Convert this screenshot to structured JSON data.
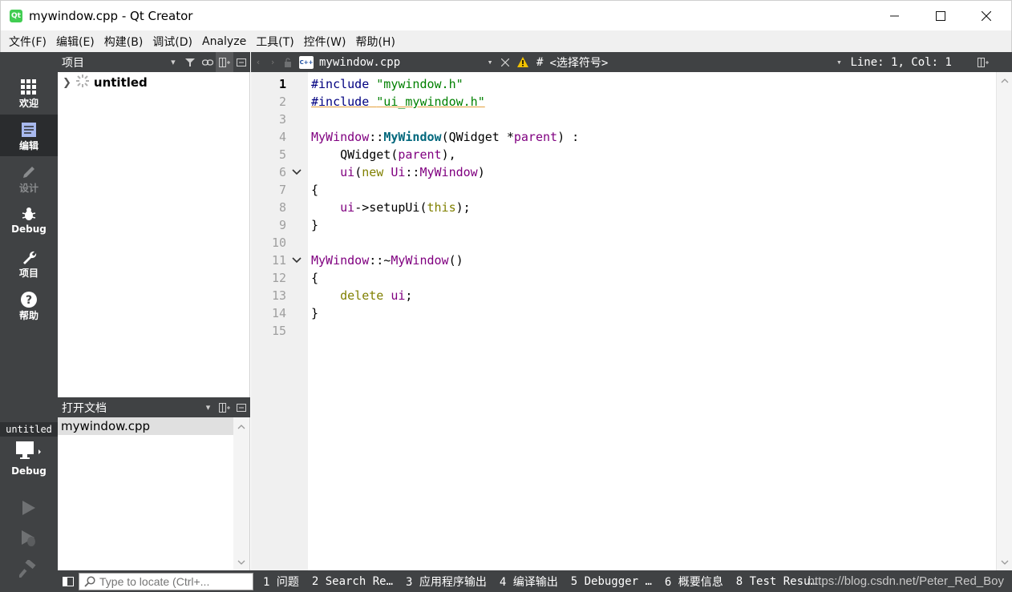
{
  "window": {
    "title": "mywindow.cpp - Qt Creator",
    "app_icon": "Qt"
  },
  "menu": [
    "文件(F)",
    "编辑(E)",
    "构建(B)",
    "调试(D)",
    "Analyze",
    "工具(T)",
    "控件(W)",
    "帮助(H)"
  ],
  "modes": [
    {
      "label": "欢迎",
      "icon": "grid-icon"
    },
    {
      "label": "编辑",
      "icon": "edit-doc-icon"
    },
    {
      "label": "设计",
      "icon": "pencil-icon"
    },
    {
      "label": "Debug",
      "icon": "bug-icon"
    },
    {
      "label": "项目",
      "icon": "wrench-icon"
    },
    {
      "label": "帮助",
      "icon": "help-icon"
    }
  ],
  "kit": {
    "name": "untitled",
    "target": "Debug"
  },
  "project_panel": {
    "title": "项目",
    "tree_item": "untitled"
  },
  "open_docs": {
    "title": "打开文档",
    "item": "mywindow.cpp"
  },
  "editor": {
    "file_badge": "C++",
    "file_name": "mywindow.cpp",
    "hash": "#",
    "symbol": "<选择符号>",
    "line_col": "Line: 1, Col: 1",
    "current_line": 1,
    "line_numbers": [
      "1",
      "2",
      "3",
      "4",
      "5",
      "6",
      "7",
      "8",
      "9",
      "10",
      "11",
      "12",
      "13",
      "14",
      "15"
    ]
  },
  "code": {
    "l1_pp": "#include ",
    "l1_str": "\"mywindow.h\"",
    "l2_pp": "#include ",
    "l2_str": "\"ui_mywindow.h\"",
    "l4_ty": "MyWindow",
    "l4_sep": "::",
    "l4_fn": "MyWindow",
    "l4_rest1": "(QWidget *",
    "l4_param": "parent",
    "l4_rest2": ") :",
    "l5_pre": "    QWidget(",
    "l5_param": "parent",
    "l5_post": "),",
    "l6_pre": "    ",
    "l6_mem": "ui",
    "l6_p1": "(",
    "l6_kw": "new",
    "l6_sp": " ",
    "l6_ns": "Ui",
    "l6_sep": "::",
    "l6_ty": "MyWindow",
    "l6_post": ")",
    "l7": "{",
    "l8_pre": "    ",
    "l8_mem": "ui",
    "l8_mid": "->setupUi(",
    "l8_kw": "this",
    "l8_post": ");",
    "l9": "}",
    "l11_ty": "MyWindow",
    "l11_sep": "::~",
    "l11_ty2": "MyWindow",
    "l11_post": "()",
    "l12": "{",
    "l13_pre": "    ",
    "l13_kw": "delete",
    "l13_sp": " ",
    "l13_mem": "ui",
    "l13_post": ";",
    "l14": "}"
  },
  "status": {
    "locator_placeholder": "Type to locate (Ctrl+...",
    "panes": [
      "1 问题",
      "2 Search Re…",
      "3 应用程序输出",
      "4 编译输出",
      "5 Debugger …",
      "6 概要信息",
      "8 Test Resu…"
    ],
    "watermark": "https://blog.csdn.net/Peter_Red_Boy"
  }
}
